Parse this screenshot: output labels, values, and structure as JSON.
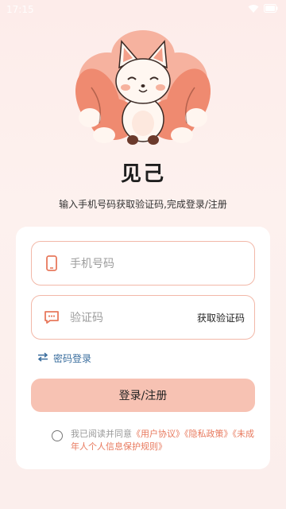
{
  "status_bar": {
    "time": "17:15"
  },
  "app": {
    "name": "见己",
    "subtitle": "输入手机号码获取验证码,完成登录/注册"
  },
  "form": {
    "phone_placeholder": "手机号码",
    "code_placeholder": "验证码",
    "get_code_label": "获取验证码",
    "password_login_label": "密码登录",
    "submit_label": "登录/注册"
  },
  "agreement": {
    "prefix": "我已阅读并同意",
    "user_agreement": "《用户协议》",
    "privacy_policy": "《隐私政策》",
    "minor_rules": "《未成年人个人信息保护规则》"
  },
  "colors": {
    "accent": "#e8795d",
    "button_bg": "#f7c2b3",
    "field_border": "#f2b8a8",
    "link_blue": "#3a6e9e"
  },
  "icons": [
    "wifi-icon",
    "battery-icon",
    "phone-icon",
    "message-icon",
    "swap-icon",
    "fox-mascot-logo"
  ]
}
